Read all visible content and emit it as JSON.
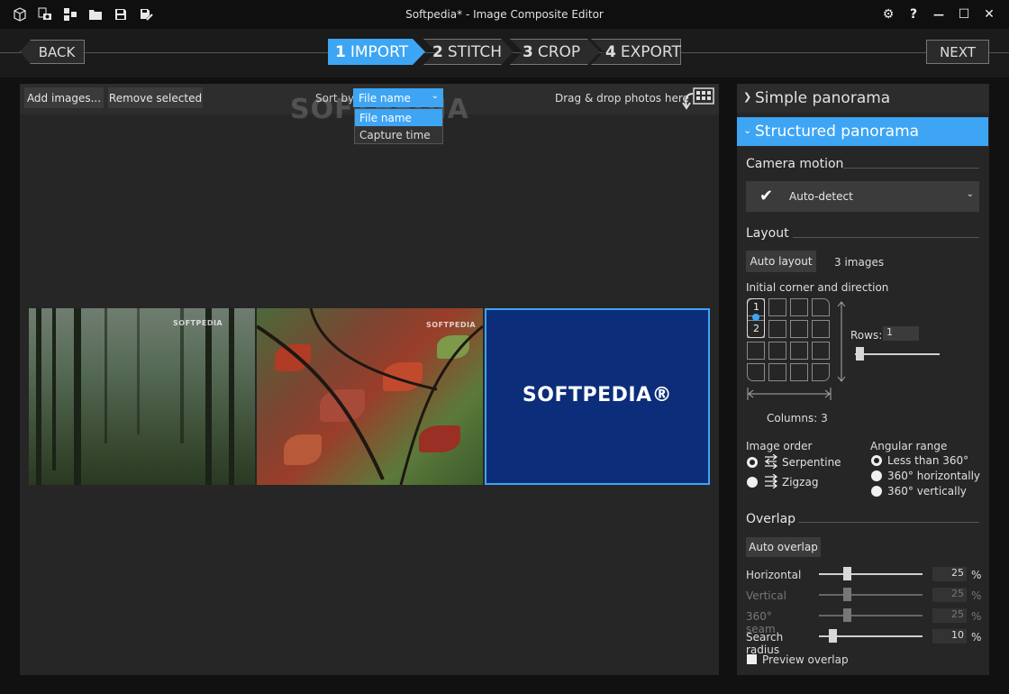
{
  "window": {
    "title": "Softpedia* - Image Composite Editor",
    "toolbar_icons": [
      "new-project-icon",
      "import-camera-icon",
      "import-images-icon",
      "open-folder-icon",
      "save-icon",
      "save-as-icon"
    ],
    "settings_icon": "⚙",
    "help_icon": "?",
    "minimize_icon": "—",
    "maximize_icon": "☐",
    "close_icon": "✕"
  },
  "nav": {
    "back_label": "BACK",
    "next_label": "NEXT",
    "steps": [
      {
        "num": "1",
        "label": "IMPORT",
        "active": true
      },
      {
        "num": "2",
        "label": "STITCH",
        "active": false
      },
      {
        "num": "3",
        "label": "CROP",
        "active": false
      },
      {
        "num": "4",
        "label": "EXPORT",
        "active": false
      }
    ]
  },
  "main": {
    "add_images_label": "Add images...",
    "remove_selected_label": "Remove selected",
    "sort_by_label": "Sort by",
    "sort_value": "File name",
    "sort_options": [
      "File name",
      "Capture time"
    ],
    "drag_hint": "Drag & drop photos here",
    "watermark": "SOFTPEDIA",
    "thumbnails": [
      {
        "name": "forest",
        "watermark": "SOFTPEDIA"
      },
      {
        "name": "leaves",
        "watermark": "SOFTPEDIA"
      },
      {
        "name": "softpedia-logo",
        "watermark": "SOFTPEDIA®",
        "selected": true
      }
    ]
  },
  "panel": {
    "simple_panorama": "Simple panorama",
    "structured_panorama": "Structured panorama",
    "camera_motion_title": "Camera motion",
    "camera_motion_value": "Auto-detect",
    "layout_title": "Layout",
    "auto_layout_label": "Auto layout",
    "image_count": "3 images",
    "corner_label": "Initial corner and direction",
    "grid_markers": [
      "1",
      "2"
    ],
    "rows_label": "Rows:",
    "rows_value": "1",
    "columns_label": "Columns:  3",
    "image_order_title": "Image order",
    "image_order_options": [
      {
        "label": "Serpentine",
        "selected": true
      },
      {
        "label": "Zigzag",
        "selected": false
      }
    ],
    "angular_range_title": "Angular range",
    "angular_range_options": [
      {
        "label": "Less than 360°",
        "selected": true
      },
      {
        "label": "360° horizontally",
        "selected": false
      },
      {
        "label": "360° vertically",
        "selected": false
      }
    ],
    "overlap_title": "Overlap",
    "auto_overlap_label": "Auto overlap",
    "overlap_rows": [
      {
        "label": "Horizontal",
        "value": "25",
        "unit": "%",
        "enabled": true,
        "level": 0.25
      },
      {
        "label": "Vertical",
        "value": "25",
        "unit": "%",
        "enabled": false,
        "level": 0.25
      },
      {
        "label": "360° seam",
        "value": "25",
        "unit": "%",
        "enabled": false,
        "level": 0.25
      },
      {
        "label": "Search radius",
        "value": "10",
        "unit": "%",
        "enabled": true,
        "level": 0.1
      }
    ],
    "preview_overlap_label": "Preview overlap"
  },
  "colors": {
    "accent": "#3da5f4",
    "background": "#1b1b1b",
    "panel": "#262626",
    "logo_blue": "#0c2d7a"
  }
}
